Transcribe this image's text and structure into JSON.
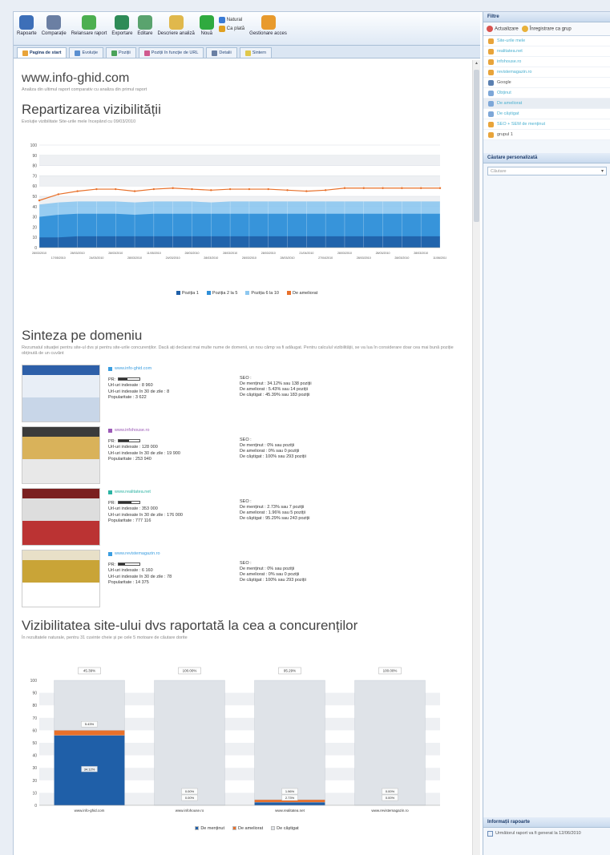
{
  "toolbar": {
    "items": [
      {
        "label": "Rapoarte",
        "icon": "reports-icon",
        "color": "#3d6fb8"
      },
      {
        "label": "Comparație",
        "icon": "compare-icon",
        "color": "#6b7fa3"
      },
      {
        "label": "Relansare raport",
        "icon": "refresh-icon",
        "color": "#4caf50"
      },
      {
        "label": "Exportare",
        "icon": "export-icon",
        "color": "#2e8b57"
      },
      {
        "label": "Editare",
        "icon": "edit-icon",
        "color": "#5aa36e"
      },
      {
        "label": "Descriere analiză",
        "icon": "description-icon",
        "color": "#e0b84c"
      },
      {
        "label": "Nouă",
        "icon": "new-icon",
        "color": "#2faa3f"
      }
    ],
    "stack": [
      "Natural",
      "Ca plată"
    ],
    "share": {
      "label": "Gestionare acces",
      "icon": "users-icon",
      "color": "#e89a2c"
    }
  },
  "tabs": [
    "Pagina de start",
    "Evoluție",
    "Poziții",
    "Poziții în funcție de URL",
    "Detalii",
    "Sintern"
  ],
  "page": {
    "site": "www.info-ghid.com",
    "site_sub": "Analiza din ultimul raport comparativ cu analiza din primul raport",
    "section1_title": "Repartizarea vizibilității",
    "section1_sub": "Evoluție vizibilitate Site-urile mele începând cu 09/03/2010",
    "section2_title": "Sinteza pe domeniu",
    "section2_sub": "Rezumatul situației pentru site-ul dvs și pentru site-urile concurenților. Dacă ați declarat mai multe nume de domenii, un nou câmp va fi adăugat. Pentru calculul vizibilității, se va lua în considerare doar cea mai bună poziție obținută de un cuvânt",
    "section3_title": "Vizibilitatea site-ului dvs raportată la cea a concurenților",
    "section3_sub": "În rezultatele naturale, pentru 31 cuvinte cheie și pe cele 5 motoare de căutare dorite"
  },
  "domains": [
    {
      "name": "www.info-ghid.com",
      "color": "#3a9de0",
      "pr": 0.4,
      "pr_label": "PR:",
      "indexed": "Url-uri indexate : 8 960",
      "indexed30": "Url-uri indexate în 30 de zile : 8",
      "pop": "Popularitate : 3 622",
      "seo": "SEO :",
      "keep": "De menținut : 34.12% sau 138 poziții",
      "improve": "De ameliorat : 5.43% sau 14 poziții",
      "gain": "De câștigat : 45.39% sau 183 poziții"
    },
    {
      "name": "www.infohouse.ro",
      "color": "#9b59b6",
      "pr": 0.5,
      "pr_label": "PR:",
      "indexed": "Url-uri indexate : 128 000",
      "indexed30": "Url-uri indexate în 30 de zile : 19 900",
      "pop": "Popularitate : 253 940",
      "seo": "SEO :",
      "keep": "De menținut : 0% sau poziții",
      "improve": "De ameliorat : 0% sau 0 poziții",
      "gain": "De câștigat : 100% sau 293 poziții"
    },
    {
      "name": "www.realitatea.net",
      "color": "#2bb3a3",
      "pr": 0.6,
      "pr_label": "PR:",
      "indexed": "Url-uri indexate : 353 000",
      "indexed30": "Url-uri indexate în 30 de zile : 176 000",
      "pop": "Popularitate : 777 116",
      "seo": "SEO :",
      "keep": "De menținut : 2.73% sau 7 poziții",
      "improve": "De ameliorat : 1.96% sau 5 poziții",
      "gain": "De câștigat : 95.29% sau 243 poziții"
    },
    {
      "name": "www.revistemagazin.ro",
      "color": "#3a9de0",
      "pr": 0.3,
      "pr_label": "PR:",
      "indexed": "Url-uri indexate : 6 160",
      "indexed30": "Url-uri indexate în 30 de zile : 78",
      "pop": "Popularitate : 14 375",
      "seo": "SEO :",
      "keep": "De menținut : 0% sau poziții",
      "improve": "De ameliorat : 0% sau 0 poziții",
      "gain": "De câștigat : 100% sau 293 poziții"
    }
  ],
  "sidebar": {
    "filter_title": "Filtre",
    "btn_update": "Actualizare",
    "btn_save": "Înregistrare ca grup",
    "items": [
      {
        "label": "Site-urile mele",
        "icon": "folder",
        "link": true
      },
      {
        "label": "realitatea.net",
        "icon": "folder",
        "link": true
      },
      {
        "label": "infohouse.ro",
        "icon": "folder",
        "link": true
      },
      {
        "label": "revistemagazin.ro",
        "icon": "folder",
        "link": true
      },
      {
        "label": "Google",
        "icon": "engine",
        "link": false
      },
      {
        "label": "Obținut",
        "icon": "check",
        "link": true
      },
      {
        "label": "De ameliorat",
        "icon": "check",
        "link": true,
        "selected": true
      },
      {
        "label": "De câștigat",
        "icon": "check",
        "link": true
      },
      {
        "label": "SEO + SEM de menținut",
        "icon": "folder",
        "link": true
      },
      {
        "label": "grupul 1",
        "icon": "folder",
        "link": false
      }
    ],
    "search_title": "Căutare personalizată",
    "search_placeholder": "Căutare",
    "info_title": "Informații rapoarte",
    "info_text": "Următorul raport va fi generat la 12/06/2010"
  },
  "chart_data": [
    {
      "type": "area",
      "x": [
        "28/03/2010",
        "17/05/2010",
        "28/03/2010",
        "24/03/2010",
        "28/03/2010",
        "28/03/2010",
        "11/05/2010",
        "24/03/2010",
        "28/03/2010",
        "28/03/2010",
        "28/03/2010",
        "28/03/2010",
        "28/03/2010",
        "28/03/2010",
        "21/04/2010",
        "27/04/2010",
        "28/03/2010",
        "28/03/2010",
        "28/03/2010",
        "28/03/2010",
        "28/03/2010",
        "11/06/2010"
      ],
      "series": [
        {
          "name": "Poziția 1",
          "color": "#1f5fa8",
          "values": [
            10,
            10,
            11,
            11,
            11,
            11,
            11,
            11,
            11,
            11,
            11,
            11,
            11,
            11,
            11,
            11,
            11,
            11,
            11,
            11,
            11,
            11
          ]
        },
        {
          "name": "Poziția 2 la 5",
          "color": "#2f8fd8",
          "values": [
            30,
            32,
            33,
            33,
            33,
            32,
            33,
            33,
            33,
            33,
            33,
            33,
            33,
            33,
            33,
            33,
            33,
            33,
            33,
            33,
            33,
            33
          ]
        },
        {
          "name": "Poziția 6 la 10",
          "color": "#8ec8f0",
          "values": [
            42,
            44,
            45,
            45,
            45,
            44,
            45,
            45,
            45,
            44,
            45,
            45,
            45,
            45,
            45,
            45,
            45,
            45,
            45,
            45,
            45,
            45
          ]
        },
        {
          "name": "De ameliorat",
          "color": "#e8702a",
          "values": [
            46,
            52,
            55,
            57,
            57,
            55,
            57,
            58,
            57,
            56,
            57,
            57,
            57,
            56,
            55,
            56,
            58,
            58,
            58,
            58,
            58,
            58
          ]
        }
      ],
      "ylim": [
        0,
        100
      ],
      "yticks": [
        0,
        10,
        20,
        30,
        40,
        50,
        60,
        70,
        80,
        90,
        100
      ]
    },
    {
      "type": "bar",
      "categories": [
        "www.info-ghid.com",
        "www.infohouse.ro",
        "www.realitatea.net",
        "www.revistemagazin.ro"
      ],
      "top_labels": [
        "45.39%",
        "100.00%",
        "95.29%",
        "100.00%"
      ],
      "series": [
        {
          "name": "De menținut",
          "color": "#1f5fa8",
          "values": [
            56,
            0,
            2.5,
            0
          ]
        },
        {
          "name": "De ameliorat",
          "color": "#e8702a",
          "values": [
            4,
            0,
            2,
            0
          ]
        },
        {
          "name": "De câștigat",
          "color": "#dfe3e8",
          "values": [
            40,
            100,
            95.5,
            100
          ]
        }
      ],
      "segment_labels": [
        {
          "keep": "34.12%",
          "improve": "5.43%"
        },
        {
          "keep": "0.00%",
          "improve": "0.00%"
        },
        {
          "keep": "2.73%",
          "improve": "1.96%"
        },
        {
          "keep": "0.00%",
          "improve": "0.00%"
        }
      ],
      "ylim": [
        0,
        100
      ],
      "yticks": [
        0,
        10,
        20,
        30,
        40,
        50,
        60,
        70,
        80,
        90,
        100
      ]
    }
  ]
}
